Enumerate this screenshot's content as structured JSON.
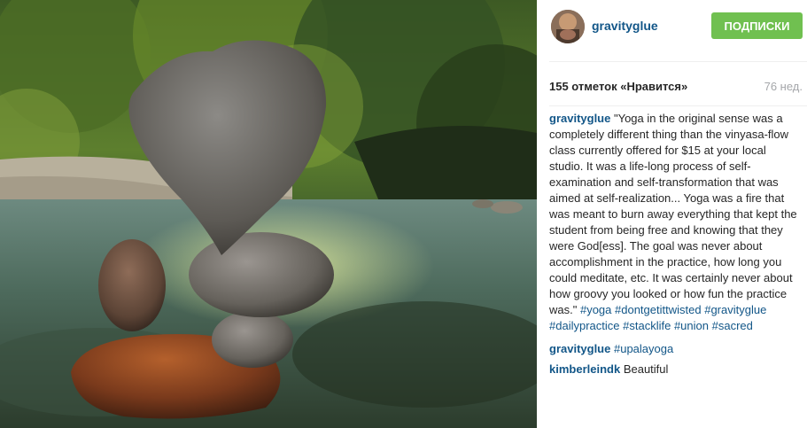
{
  "post": {
    "username": "gravityglue",
    "follow_label": "ПОДПИСКИ",
    "likes": "155 отметок «Нравится»",
    "time": "76 нед.",
    "comments": [
      {
        "user": "gravityglue",
        "text": " \"Yoga in the original sense was a completely different thing than the vinyasa-flow class currently offered for $15 at your local studio. It was a life-long process of self-examination and self-transformation that was aimed at self-realization... Yoga was a fire that was meant to burn away everything that kept the student from being free and knowing that they were God[ess]. The goal was never about accomplishment in the practice, how long you could meditate, etc. It was certainly never about how groovy you looked or how fun the practice was.\" ",
        "tags": [
          "#yoga",
          "#dontgetittwisted",
          "#gravityglue",
          "#dailypractice",
          "#stacklife",
          "#union",
          "#sacred"
        ]
      },
      {
        "user": "gravityglue",
        "text": " ",
        "tags": [
          "#upalayoga"
        ]
      },
      {
        "user": "kimberleindk",
        "text": " Beautiful",
        "tags": []
      }
    ]
  },
  "icons": {
    "avatar": "user-avatar-photo",
    "photo": "balanced-rocks-river-photo"
  },
  "colors": {
    "link": "#125688",
    "follow_button": "#70c050",
    "muted": "#a5a7aa"
  }
}
